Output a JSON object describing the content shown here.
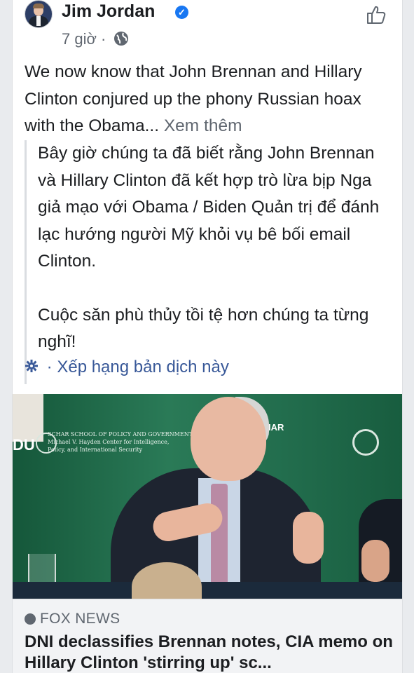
{
  "header": {
    "author": "Jim Jordan",
    "time": "7 giờ ·"
  },
  "post": {
    "text": "We now know that John Brennan and Hillary Clinton conjured up the phony Russian hoax with the Obama...",
    "see_more": "Xem thêm"
  },
  "translation": {
    "paragraph1": "Bây giờ chúng ta đã biết rằng John Brennan và Hillary Clinton đã kết hợp trò lừa bịp Nga giả mạo với Obama / Biden Quản trị để đánh lạc hướng người Mỹ khỏi vụ bê bối email Clinton.",
    "paragraph2": "Cuộc săn phù thủy tồi tệ hơn chúng ta từng nghĩ!",
    "rate_label": "· Xếp hạng bản dịch này"
  },
  "link_preview": {
    "source": "FOX NEWS",
    "headline": "DNI declassifies Brennan notes, CIA memo on Hillary Clinton 'stirring up' sc..."
  },
  "icons": {
    "verified": "verified-badge-icon",
    "privacy": "globe-icon",
    "like": "thumbs-up-icon",
    "rate": "gear-icon"
  },
  "colors": {
    "link": "#385898",
    "verified": "#1877f2",
    "secondary_text": "#606770"
  }
}
